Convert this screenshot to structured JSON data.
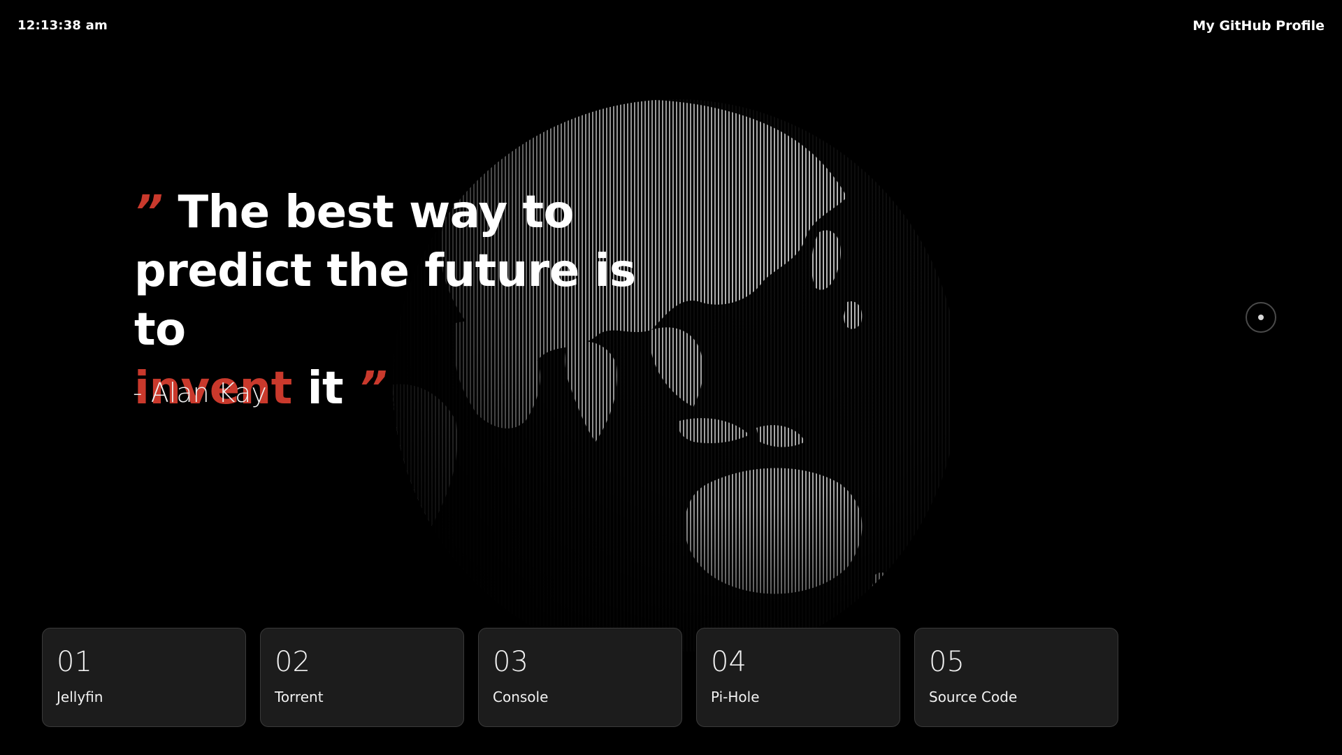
{
  "header": {
    "time": "12:13:38 am",
    "github_link": "My GitHub Profile"
  },
  "quote": {
    "open_mark": "”",
    "line1": "The best way to",
    "line2": "predict the future is to",
    "highlight": "invent",
    "tail": "it",
    "close_mark": "”",
    "author": "- Alan Kay"
  },
  "colors": {
    "accent": "#c9392c",
    "background": "#000000",
    "card_background": "#1c1c1c",
    "card_border": "#3a3a3a"
  },
  "cards": [
    {
      "number": "01",
      "label": "Jellyfin"
    },
    {
      "number": "02",
      "label": "Torrent"
    },
    {
      "number": "03",
      "label": "Console"
    },
    {
      "number": "04",
      "label": "Pi-Hole"
    },
    {
      "number": "05",
      "label": "Source Code"
    }
  ],
  "icons": {
    "globe": "earth-globe-icon",
    "nav_dot": "scroll-indicator-icon"
  }
}
